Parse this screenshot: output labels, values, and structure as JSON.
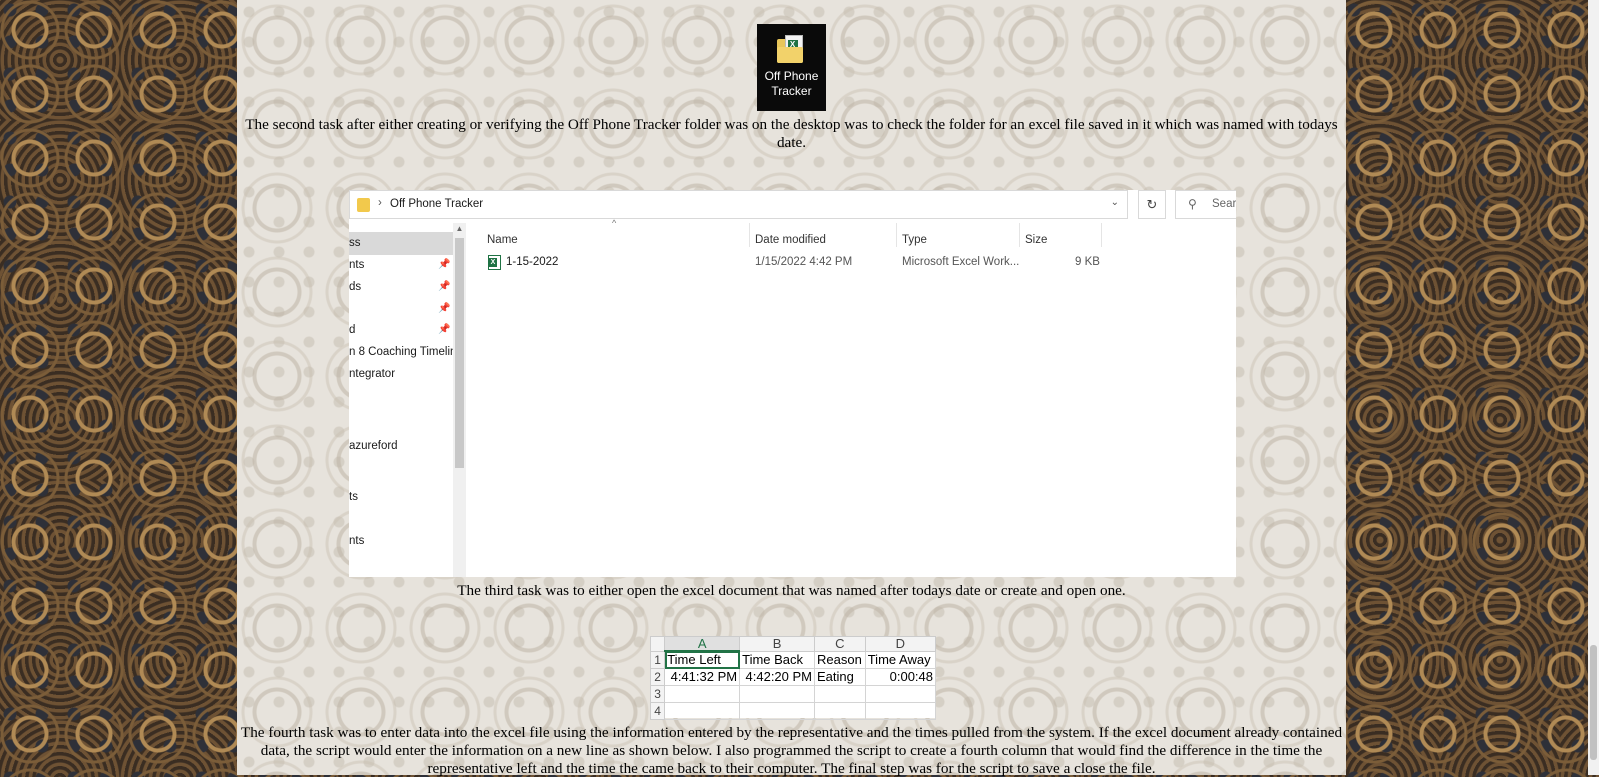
{
  "desktop_icon": {
    "label_line1": "Off Phone",
    "label_line2": "Tracker",
    "icon": "folder-with-excel-icon"
  },
  "paragraphs": {
    "second_task": "The second task after either creating or verifying the Off Phone Tracker folder was on the desktop was to check the folder for an excel file saved in it which was named with todays date.",
    "third_task": "The third task was to either open the excel document that was named after todays date or create and open one.",
    "fourth_task": "The fourth task was to enter data into the excel file using the information entered by the representative and the times pulled from the system. If the excel document already contained data, the script would enter the information on a new line as shown below. I also programmed the script to create a fourth column that would find the difference in the time the representative left and the time the came back to their computer. The final step was for the script to save a close the file."
  },
  "explorer": {
    "address_path": "Off Phone Tracker",
    "search_placeholder": "Search Off",
    "nav_items": [
      {
        "label": "ss",
        "pinned": false
      },
      {
        "label": "nts",
        "pinned": true
      },
      {
        "label": "ds",
        "pinned": true
      },
      {
        "label": "",
        "pinned": true
      },
      {
        "label": "d",
        "pinned": true
      },
      {
        "label": "n 8 Coaching Timelin",
        "pinned": false
      },
      {
        "label": "ntegrator",
        "pinned": false
      },
      {
        "label": "azureford",
        "pinned": false
      },
      {
        "label": "ts",
        "pinned": false
      },
      {
        "label": "nts",
        "pinned": false
      }
    ],
    "columns": [
      "Name",
      "Date modified",
      "Type",
      "Size"
    ],
    "files": [
      {
        "name": "1-15-2022",
        "date_modified": "1/15/2022 4:42 PM",
        "type": "Microsoft Excel Work...",
        "size": "9 KB"
      }
    ]
  },
  "excel": {
    "col_letters": [
      "A",
      "B",
      "C",
      "D"
    ],
    "row_numbers": [
      "1",
      "2",
      "3",
      "4"
    ],
    "rows": [
      [
        "Time Left",
        "Time Back",
        "Reason",
        "Time Away"
      ],
      [
        "4:41:32 PM",
        "4:42:20 PM",
        "Eating",
        "0:00:48"
      ],
      [
        "",
        "",
        "",
        ""
      ],
      [
        "",
        "",
        "",
        ""
      ]
    ]
  }
}
